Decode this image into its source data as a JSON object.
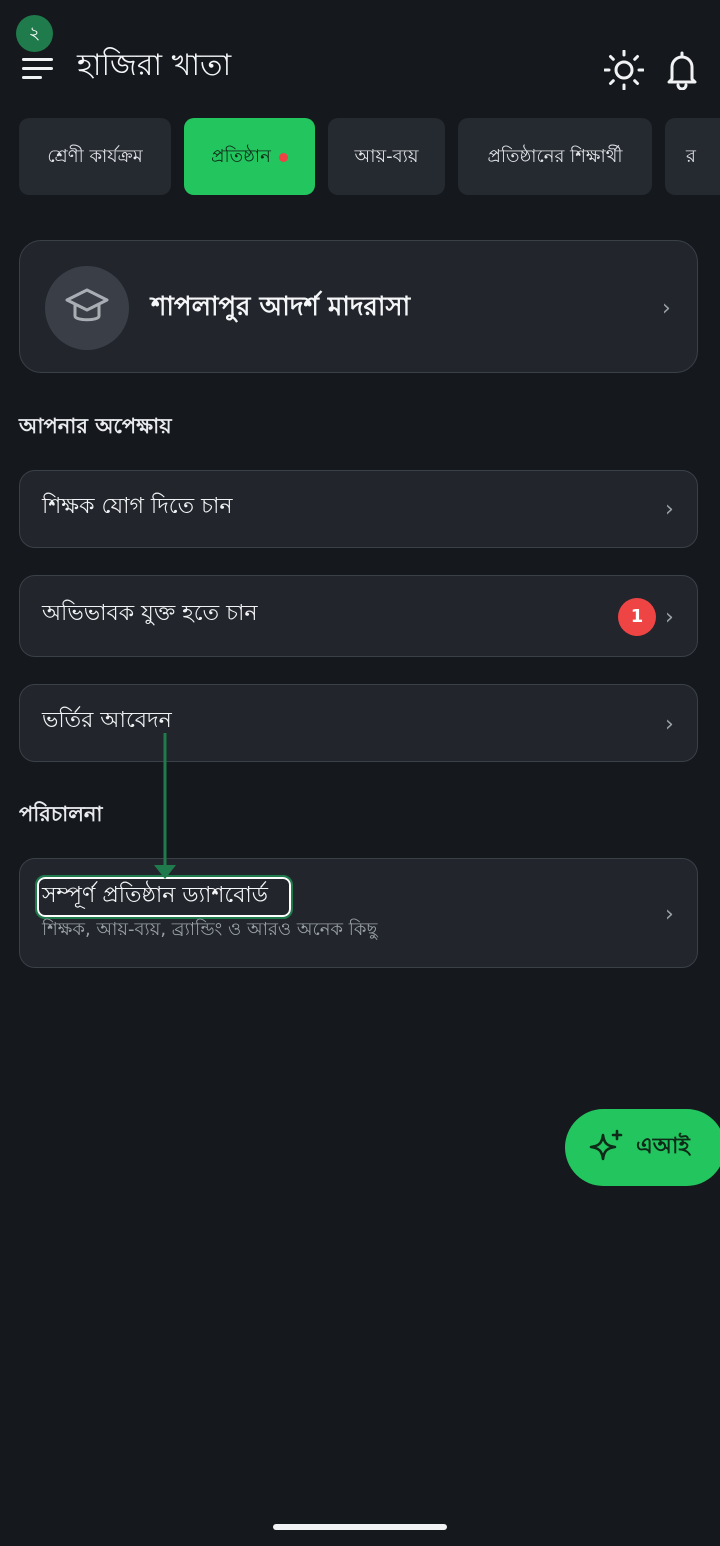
{
  "step_marker": "২",
  "header": {
    "title": "হাজিরা খাতা",
    "icons": [
      "menu-icon",
      "sun-icon",
      "bell-icon"
    ]
  },
  "tabs": [
    {
      "label": "শ্রেণী কার্যক্রম",
      "active": false
    },
    {
      "label": "প্রতিষ্ঠান",
      "active": true,
      "has_dot": true
    },
    {
      "label": "আয়-ব্যয়",
      "active": false
    },
    {
      "label": "প্রতিষ্ঠানের শিক্ষার্থী",
      "active": false
    },
    {
      "label": "র",
      "active": false
    }
  ],
  "institution": {
    "name": "শাপলাপুর আদর্শ মাদরাসা",
    "icon": "graduation-cap-icon"
  },
  "pending": {
    "title": "আপনার অপেক্ষায়",
    "items": [
      {
        "label": "শিক্ষক যোগ দিতে চান",
        "badge": ""
      },
      {
        "label": "অভিভাবক যুক্ত হতে চান",
        "badge": "1"
      },
      {
        "label": "ভর্তির আবেদন",
        "badge": ""
      }
    ]
  },
  "management": {
    "title": "পরিচালনা",
    "dashboard_title": "সম্পূর্ণ প্রতিষ্ঠান ড্যাশবোর্ড",
    "dashboard_subtitle": "শিক্ষক, আয়-ব্যয়, ব্র্যান্ডিং ও আরও অনেক কিছু"
  },
  "ai_fab": {
    "label": "এআই",
    "icon": "sparkle-icon"
  },
  "colors": {
    "background": "#15181c",
    "card": "#22262c",
    "accent_green": "#22c55e",
    "badge_red": "#ef4444",
    "annotation_green": "#1f7a4c"
  }
}
